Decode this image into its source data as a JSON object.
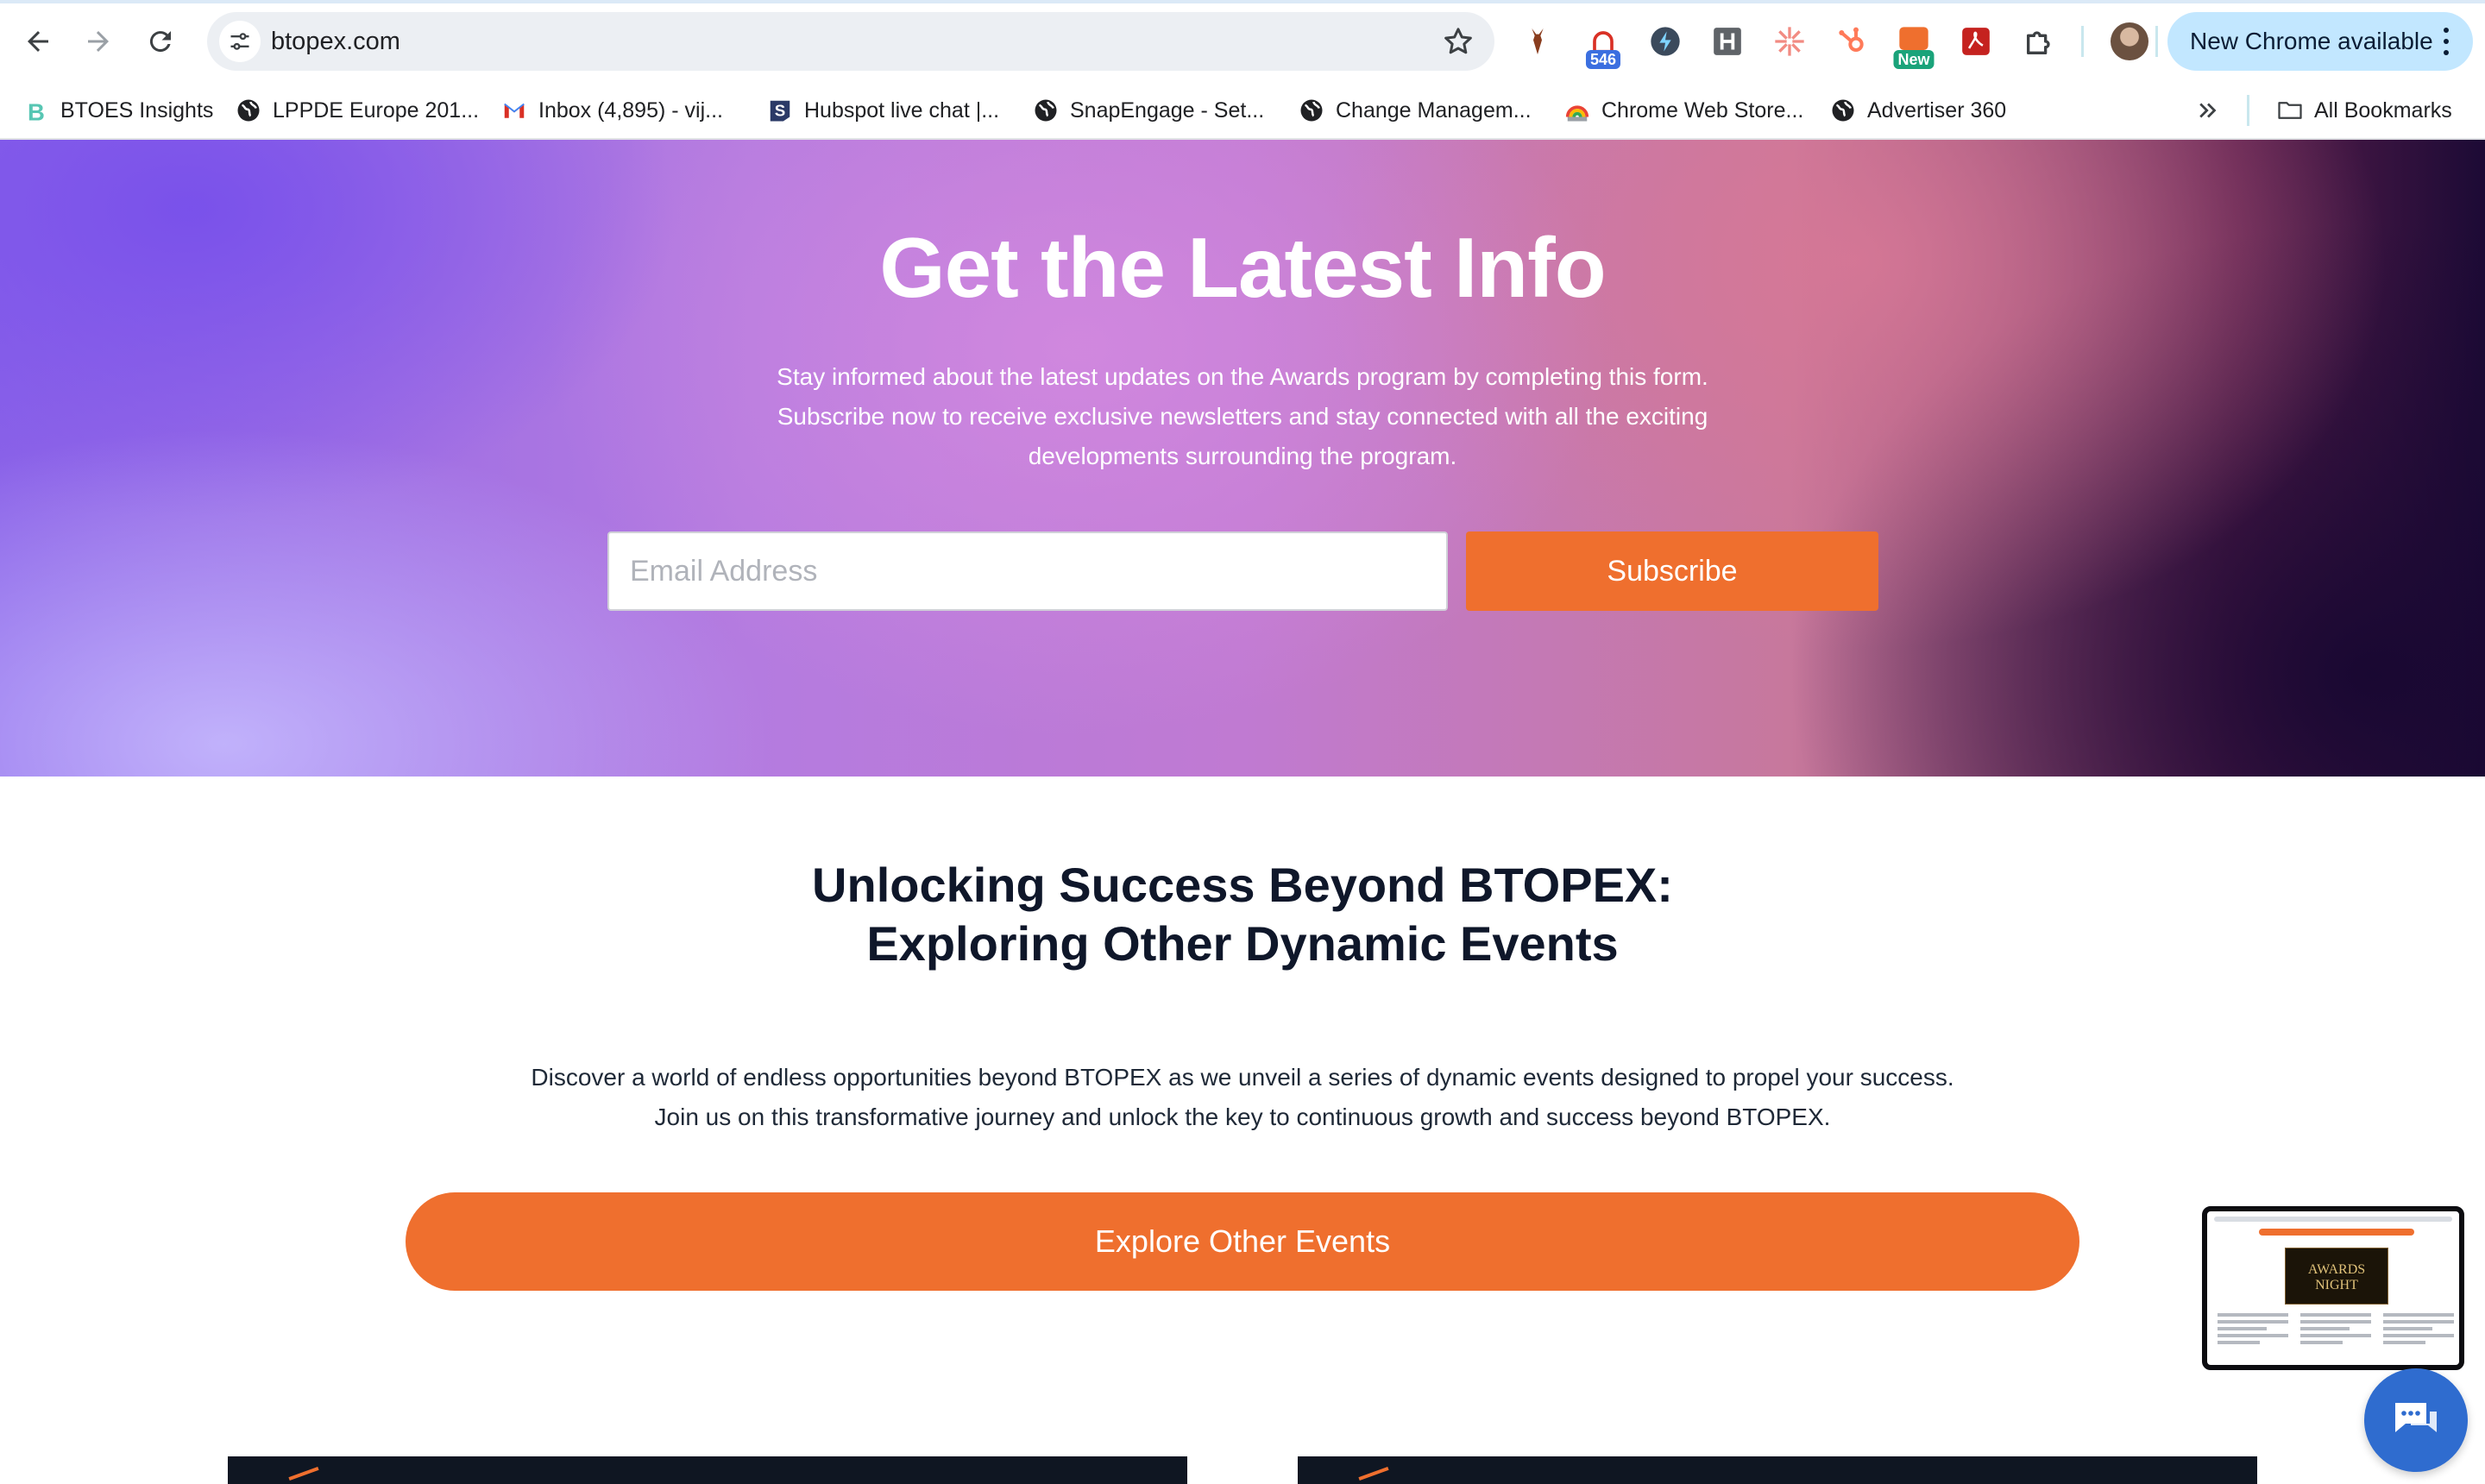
{
  "browser": {
    "url": "btopex.com",
    "update_label": "New Chrome available",
    "extensions": [
      {
        "name": "ghost-extension",
        "badge": "546",
        "badge_color": "#3b6fe0"
      },
      {
        "name": "new-extension",
        "badge": "New",
        "badge_color": "#1aa37a"
      }
    ]
  },
  "bookmarks": [
    {
      "label": "BTOES Insights",
      "icon": "btoes-b-icon"
    },
    {
      "label": "LPPDE Europe 201...",
      "icon": "globe-icon"
    },
    {
      "label": "Inbox (4,895) - vij...",
      "icon": "gmail-icon"
    },
    {
      "label": "Hubspot live chat |...",
      "icon": "s-logo-icon"
    },
    {
      "label": "SnapEngage - Set...",
      "icon": "globe-icon"
    },
    {
      "label": "Change Managem...",
      "icon": "globe-icon"
    },
    {
      "label": "Chrome Web Store...",
      "icon": "rainbow-icon"
    },
    {
      "label": "Advertiser 360",
      "icon": "globe-icon"
    }
  ],
  "all_bookmarks_label": "All Bookmarks",
  "hero": {
    "title": "Get the Latest Info",
    "description": "Stay informed about the latest updates on the Awards program by completing this form. Subscribe now to receive exclusive newsletters and stay connected with all the exciting developments surrounding the program.",
    "email_placeholder": "Email Address",
    "email_value": "",
    "subscribe_label": "Subscribe"
  },
  "events": {
    "title_line1": "Unlocking Success Beyond BTOPEX:",
    "title_line2": "Exploring Other Dynamic Events",
    "description_line1": "Discover a world of endless opportunities beyond BTOPEX as we unveil a series of dynamic events designed to propel your success.",
    "description_line2": "Join us on this transformative journey and unlock the key to continuous growth and success beyond BTOPEX.",
    "button_label": "Explore Other Events"
  },
  "preview": {
    "image_text": "AWARDS NIGHT"
  },
  "colors": {
    "accent": "#ef6f2e",
    "chat": "#2f6ccf",
    "heading": "#0f172a"
  }
}
